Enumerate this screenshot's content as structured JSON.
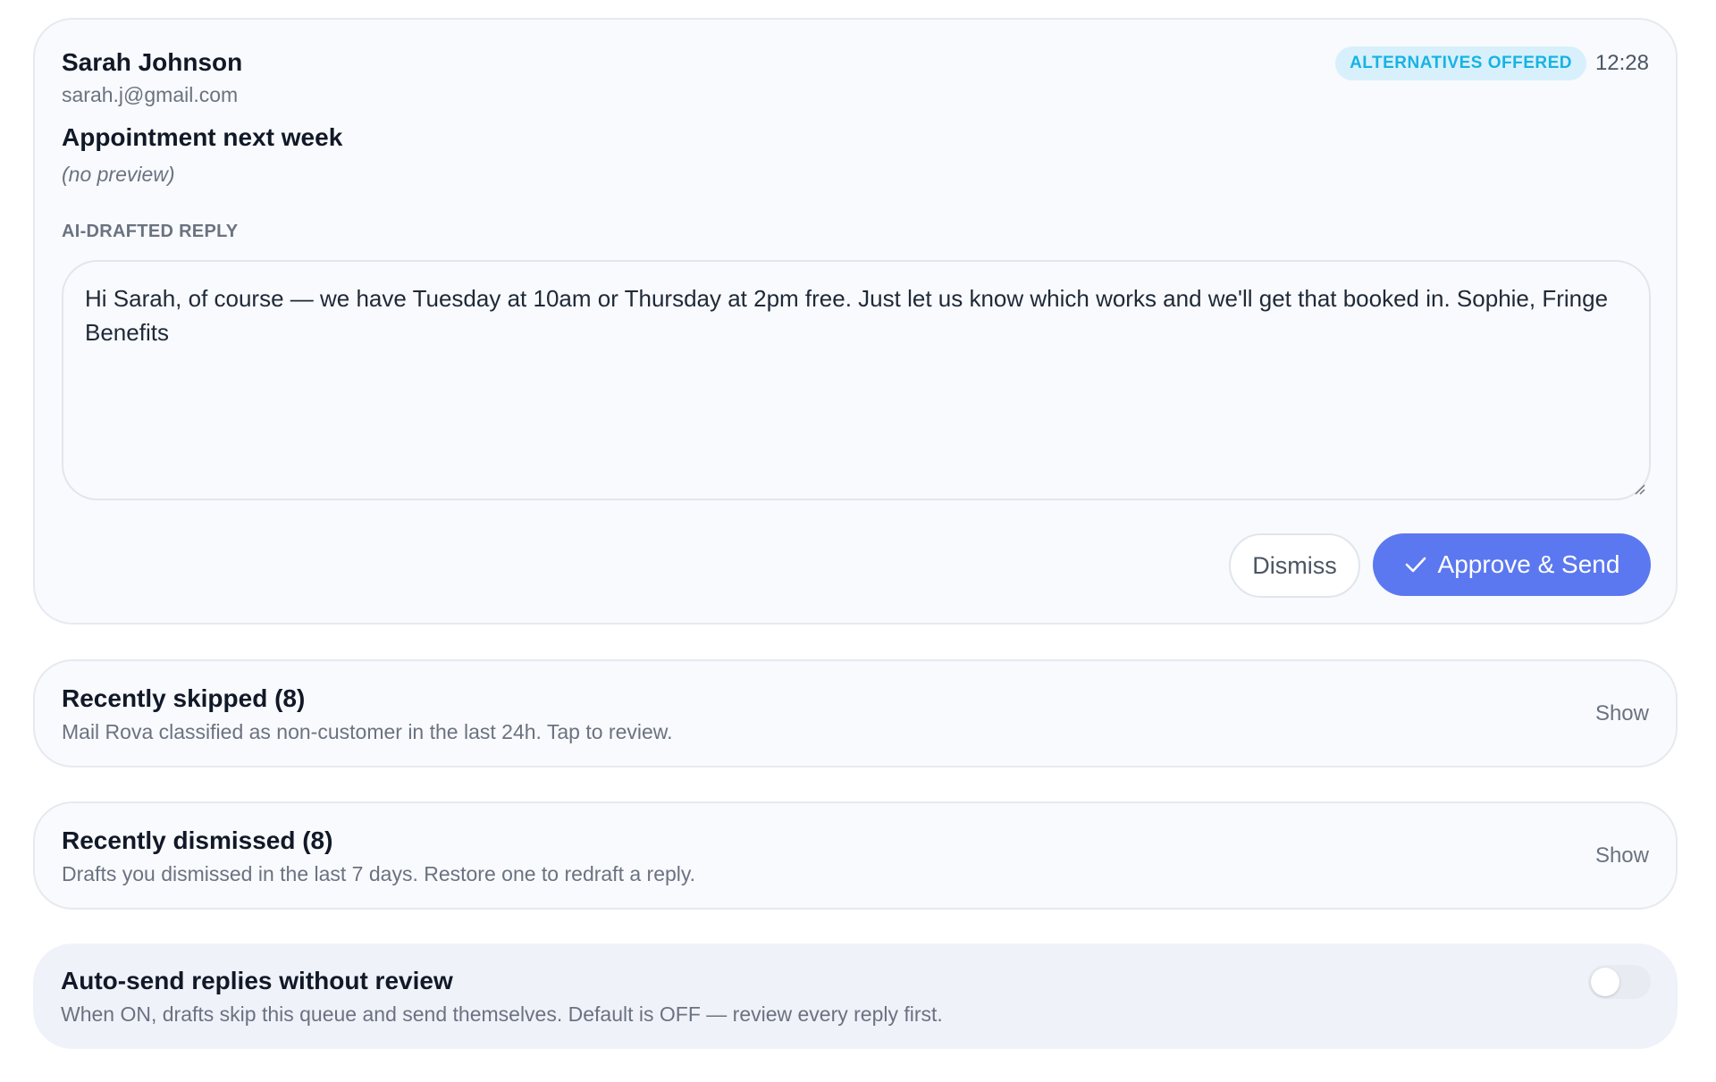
{
  "email": {
    "sender_name": "Sarah Johnson",
    "sender_email": "sarah.j@gmail.com",
    "status_badge": "ALTERNATIVES OFFERED",
    "time": "12:28",
    "subject": "Appointment next week",
    "preview": "(no preview)",
    "draft_label": "AI-DRAFTED REPLY",
    "draft_text": "Hi Sarah, of course — we have Tuesday at 10am or Thursday at 2pm free. Just let us know which works and we'll get that booked in. Sophie, Fringe Benefits",
    "dismiss_label": "Dismiss",
    "approve_label": "Approve & Send",
    "approve_icon": "check-icon"
  },
  "skipped": {
    "title": "Recently skipped (8)",
    "subtitle": "Mail Rova classified as non-customer in the last 24h. Tap to review.",
    "show_label": "Show"
  },
  "dismissed": {
    "title": "Recently dismissed (8)",
    "subtitle": "Drafts you dismissed in the last 7 days. Restore one to redraft a reply.",
    "show_label": "Show"
  },
  "autosend": {
    "title": "Auto-send replies without review",
    "subtitle": "When ON, drafts skip this queue and send themselves. Default is OFF — review every reply first.",
    "enabled": false
  },
  "colors": {
    "accent": "#5b78f0",
    "badge_bg": "#d8f0fb",
    "badge_text": "#16b3e4"
  }
}
